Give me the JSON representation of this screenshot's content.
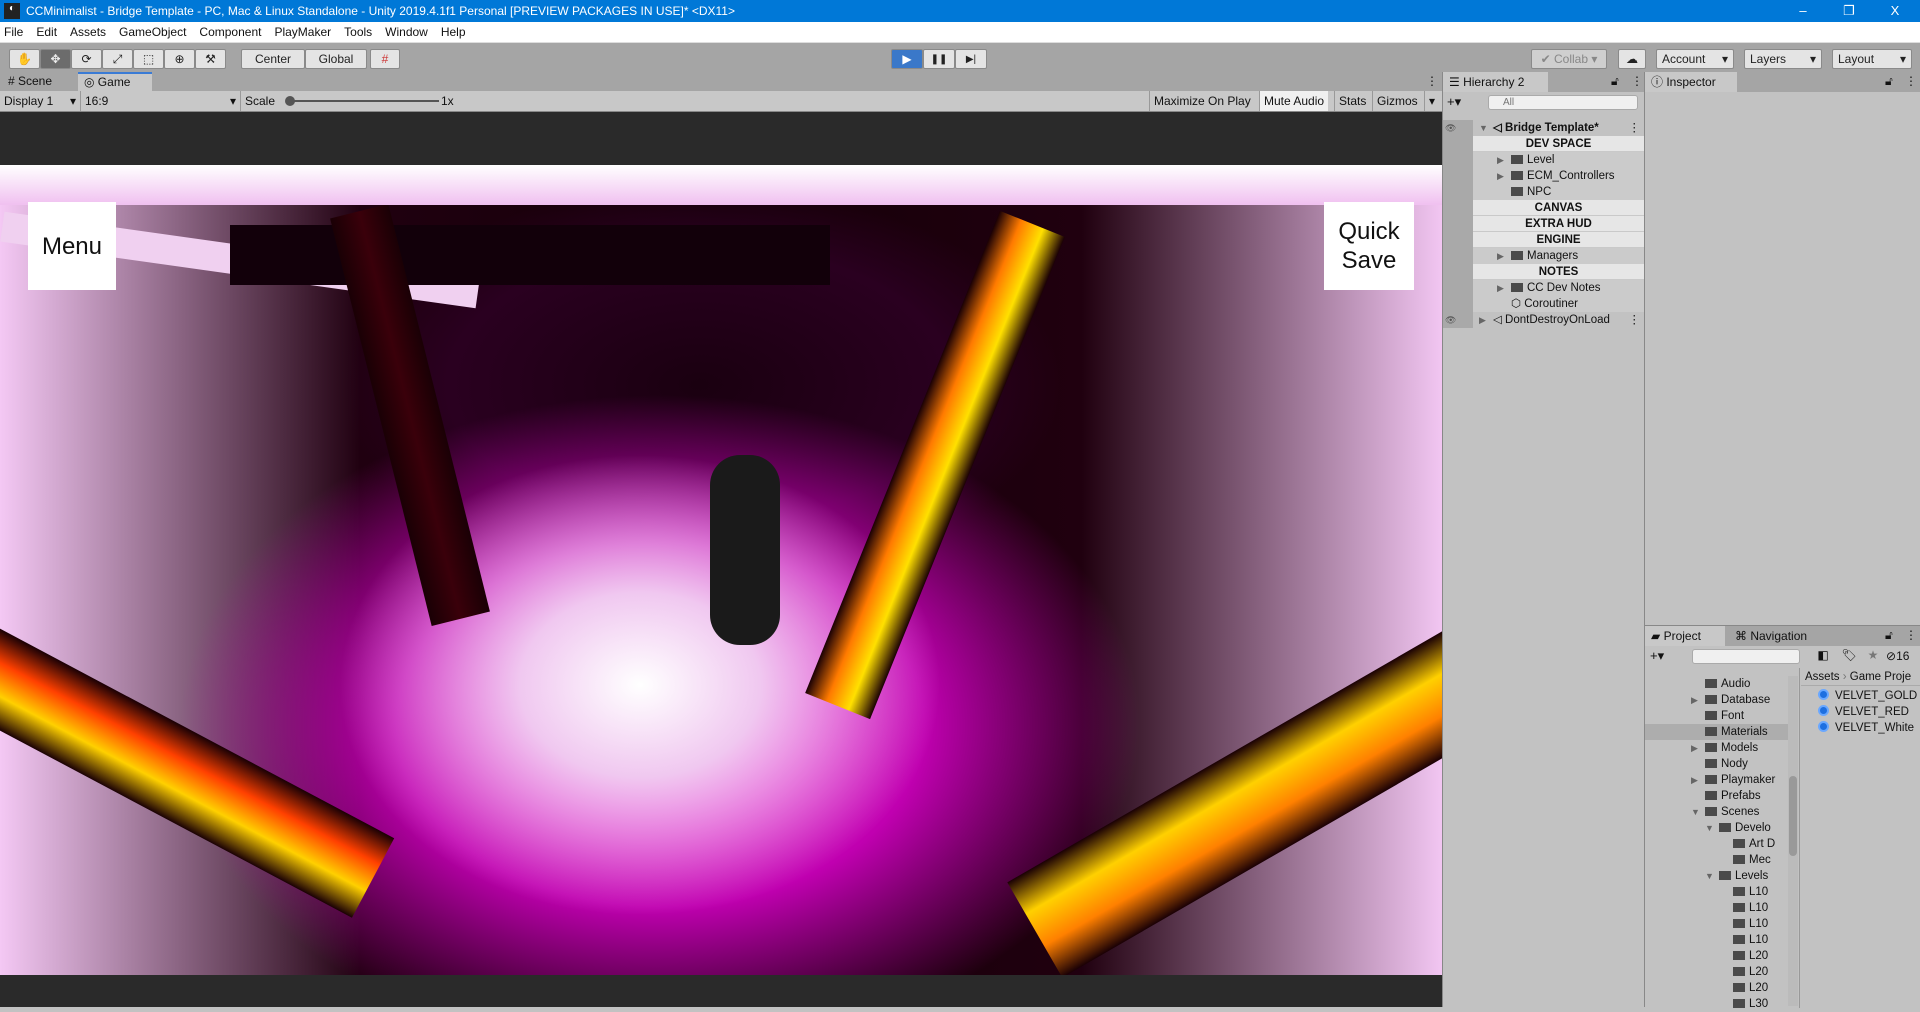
{
  "window": {
    "title": "CCMinimalist - Bridge Template - PC, Mac & Linux Standalone - Unity 2019.4.1f1 Personal [PREVIEW PACKAGES IN USE]* <DX11>",
    "minimize": "–",
    "maximize": "❐",
    "close": "X"
  },
  "menu": [
    "File",
    "Edit",
    "Assets",
    "GameObject",
    "Component",
    "PlayMaker",
    "Tools",
    "Window",
    "Help"
  ],
  "toolbar": {
    "tools": [
      "✋",
      "✥",
      "⟳",
      "⤢",
      "⬚",
      "⊕",
      "⚒"
    ],
    "pivot": "Center",
    "space": "Global",
    "snap": "#",
    "play": "▶",
    "pause": "❚❚",
    "step": "▶|",
    "collab": "✔ Collab ▾",
    "cloud": "☁",
    "account": "Account",
    "layers": "Layers",
    "layout": "Layout"
  },
  "tabs": {
    "scene": "# Scene",
    "game": "◎ Game"
  },
  "gamebar": {
    "display": "Display 1",
    "aspect": "16:9",
    "scale_label": "Scale",
    "scale_value": "1x",
    "scale_fraction": 0.0,
    "maximize": "Maximize On Play",
    "mute": "Mute Audio",
    "stats": "Stats",
    "gizmos": "Gizmos"
  },
  "game": {
    "menu_button": "Menu",
    "quicksave_button": "Quick Save"
  },
  "hierarchy": {
    "title": "Hierarchy 2",
    "search_placeholder": "All",
    "add": "+▾",
    "rows": [
      {
        "label": "Bridge Template*",
        "type": "scene"
      },
      {
        "label": "DEV SPACE",
        "type": "sep"
      },
      {
        "label": "Level",
        "type": "folder",
        "arrow": "▶"
      },
      {
        "label": "ECM_Controllers",
        "type": "folder",
        "arrow": "▶"
      },
      {
        "label": "NPC",
        "type": "folder",
        "arrow": ""
      },
      {
        "label": "CANVAS",
        "type": "sep"
      },
      {
        "label": "EXTRA HUD",
        "type": "sep"
      },
      {
        "label": "ENGINE",
        "type": "sep"
      },
      {
        "label": "Managers",
        "type": "folder",
        "arrow": "▶"
      },
      {
        "label": "NOTES",
        "type": "sep"
      },
      {
        "label": "CC Dev Notes",
        "type": "folder",
        "arrow": "▶"
      },
      {
        "label": "Coroutiner",
        "type": "object",
        "arrow": ""
      },
      {
        "label": "DontDestroyOnLoad",
        "type": "scene"
      }
    ]
  },
  "inspector": {
    "title": "Inspector"
  },
  "project": {
    "tab": "Project",
    "nav_tab": "Navigation",
    "hidden_count": "16",
    "breadcrumb": [
      "Assets",
      "Game Proje"
    ],
    "tree": [
      {
        "label": "Audio",
        "depth": 0,
        "arrow": ""
      },
      {
        "label": "Database",
        "depth": 0,
        "arrow": "▶"
      },
      {
        "label": "Font",
        "depth": 0,
        "arrow": ""
      },
      {
        "label": "Materials",
        "depth": 0,
        "arrow": "",
        "selected": true
      },
      {
        "label": "Models",
        "depth": 0,
        "arrow": "▶"
      },
      {
        "label": "Nody",
        "depth": 0,
        "arrow": ""
      },
      {
        "label": "Playmaker",
        "depth": 0,
        "arrow": "▶"
      },
      {
        "label": "Prefabs",
        "depth": 0,
        "arrow": ""
      },
      {
        "label": "Scenes",
        "depth": 0,
        "arrow": "▼"
      },
      {
        "label": "Develo",
        "depth": 1,
        "arrow": "▼"
      },
      {
        "label": "Art D",
        "depth": 2,
        "arrow": ""
      },
      {
        "label": "Mec",
        "depth": 2,
        "arrow": ""
      },
      {
        "label": "Levels",
        "depth": 1,
        "arrow": "▼"
      },
      {
        "label": "L10",
        "depth": 2,
        "arrow": ""
      },
      {
        "label": "L10",
        "depth": 2,
        "arrow": ""
      },
      {
        "label": "L10",
        "depth": 2,
        "arrow": ""
      },
      {
        "label": "L10",
        "depth": 2,
        "arrow": ""
      },
      {
        "label": "L20",
        "depth": 2,
        "arrow": ""
      },
      {
        "label": "L20",
        "depth": 2,
        "arrow": ""
      },
      {
        "label": "L20",
        "depth": 2,
        "arrow": ""
      },
      {
        "label": "L30",
        "depth": 2,
        "arrow": ""
      }
    ],
    "assets": [
      "VELVET_GOLD",
      "VELVET_RED",
      "VELVET_White"
    ]
  }
}
